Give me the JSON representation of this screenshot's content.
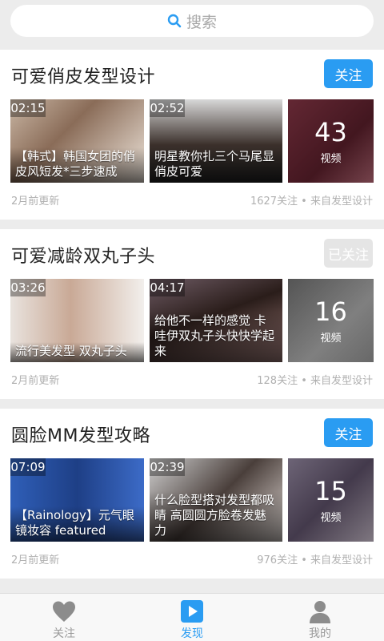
{
  "search": {
    "placeholder": "搜索"
  },
  "cards": [
    {
      "title": "可爱俏皮发型设计",
      "follow_label": "关注",
      "followed": false,
      "videos": [
        {
          "duration": "02:15",
          "caption": "【韩式】韩国女团的俏皮风短发*三步速成"
        },
        {
          "duration": "02:52",
          "caption": "明星教你扎三个马尾显俏皮可爱"
        }
      ],
      "count": "43",
      "count_label": "视频",
      "updated": "2月前更新",
      "meta": "1627关注 • 来自发型设计"
    },
    {
      "title": "可爱减龄双丸子头",
      "follow_label": "已关注",
      "followed": true,
      "videos": [
        {
          "duration": "03:26",
          "caption": "流行美发型 双丸子头"
        },
        {
          "duration": "04:17",
          "caption": "给他不一样的感觉 卡哇伊双丸子头快快学起来"
        }
      ],
      "count": "16",
      "count_label": "视频",
      "updated": "2月前更新",
      "meta": "128关注 • 来自发型设计"
    },
    {
      "title": "圆脸MM发型攻略",
      "follow_label": "关注",
      "followed": false,
      "videos": [
        {
          "duration": "07:09",
          "caption": "【Rainology】元气眼镜妆容 featured"
        },
        {
          "duration": "02:39",
          "caption": "什么脸型搭对发型都吸睛 高圆圆方脸卷发魅力"
        }
      ],
      "count": "15",
      "count_label": "视频",
      "updated": "2月前更新",
      "meta": "976关注 • 来自发型设计"
    }
  ],
  "tabbar": {
    "items": [
      {
        "label": "关注",
        "icon": "heart-icon",
        "active": false
      },
      {
        "label": "发现",
        "icon": "play-icon",
        "active": true
      },
      {
        "label": "我的",
        "icon": "user-icon",
        "active": false
      }
    ]
  },
  "colors": {
    "accent": "#2a9cf2",
    "followed_bg": "#e5e5e5",
    "muted": "#b0b0b0"
  }
}
